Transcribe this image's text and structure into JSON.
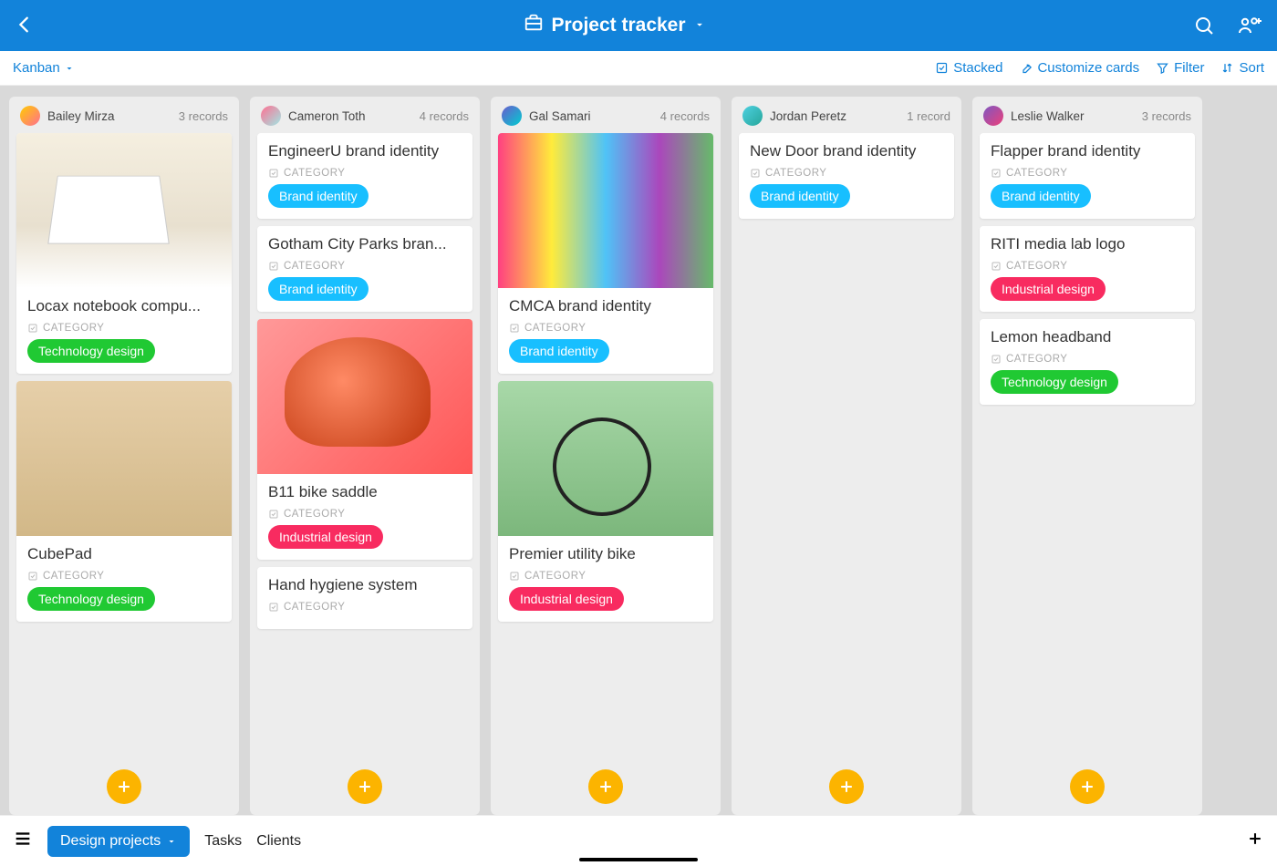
{
  "header": {
    "title": "Project tracker"
  },
  "toolbar": {
    "view": "Kanban",
    "stacked": "Stacked",
    "customize": "Customize cards",
    "filter": "Filter",
    "sort": "Sort"
  },
  "category_label": "CATEGORY",
  "tag_colors": {
    "Brand identity": "brand",
    "Technology design": "tech",
    "Industrial design": "industrial"
  },
  "columns": [
    {
      "name": "Bailey Mirza",
      "count": "3 records",
      "avatar_bg": "linear-gradient(135deg,#ffcc00,#ff6f91)",
      "cards": [
        {
          "title": "Locax notebook compu...",
          "tag": "Technology design",
          "image": "img-1"
        },
        {
          "title": "CubePad",
          "tag": "Technology design",
          "image": "img-2"
        }
      ]
    },
    {
      "name": "Cameron Toth",
      "count": "4 records",
      "avatar_bg": "linear-gradient(135deg,#ff6f91,#a0e7e5)",
      "cards": [
        {
          "title": "EngineerU brand identity",
          "tag": "Brand identity"
        },
        {
          "title": "Gotham City Parks bran...",
          "tag": "Brand identity"
        },
        {
          "title": "B11 bike saddle",
          "tag": "Industrial design",
          "image": "img-3"
        },
        {
          "title": "Hand hygiene system"
        }
      ]
    },
    {
      "name": "Gal Samari",
      "count": "4 records",
      "avatar_bg": "linear-gradient(135deg,#6a5acd,#00ced1)",
      "cards": [
        {
          "title": "CMCA brand identity",
          "tag": "Brand identity",
          "image": "img-4"
        },
        {
          "title": "Premier utility bike",
          "tag": "Industrial design",
          "image": "img-5"
        }
      ]
    },
    {
      "name": "Jordan Peretz",
      "count": "1 record",
      "avatar_bg": "linear-gradient(135deg,#4dd0e1,#26a69a)",
      "cards": [
        {
          "title": "New Door brand identity",
          "tag": "Brand identity"
        }
      ]
    },
    {
      "name": "Leslie Walker",
      "count": "3 records",
      "avatar_bg": "linear-gradient(135deg,#7e57c2,#ec407a)",
      "cards": [
        {
          "title": "Flapper brand identity",
          "tag": "Brand identity"
        },
        {
          "title": "RITI media lab logo",
          "tag": "Industrial design"
        },
        {
          "title": "Lemon headband",
          "tag": "Technology design"
        }
      ]
    }
  ],
  "tabs": {
    "active": "Design projects",
    "others": [
      "Tasks",
      "Clients"
    ]
  }
}
